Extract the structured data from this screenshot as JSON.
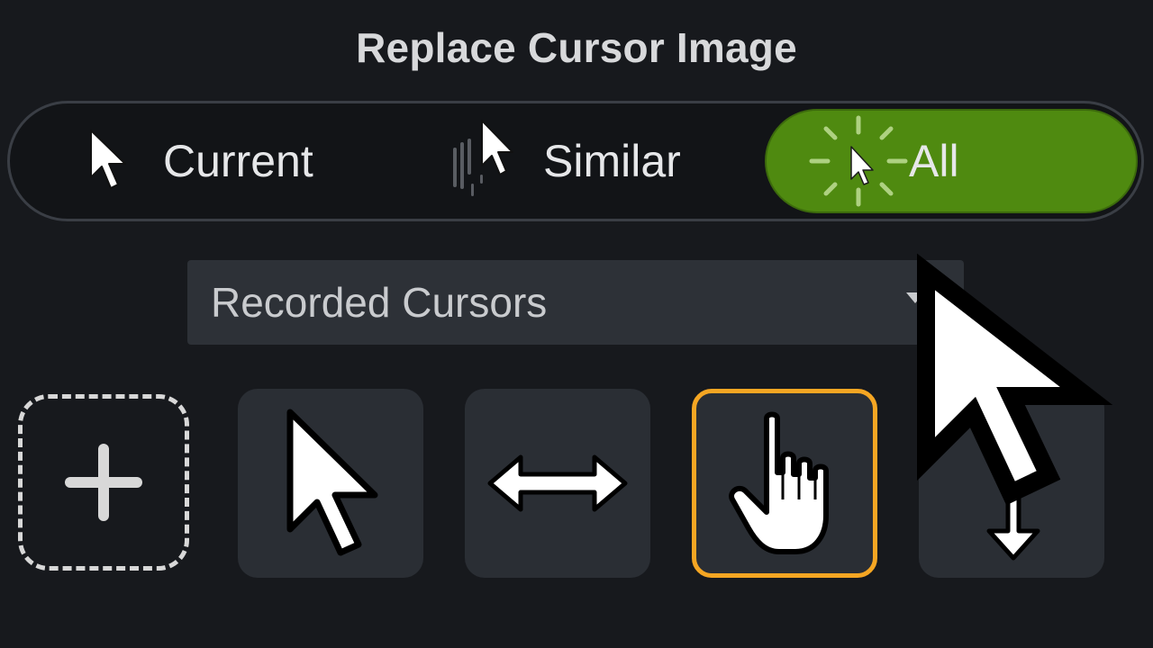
{
  "dialog": {
    "title": "Replace Cursor Image"
  },
  "scope_toggle": {
    "options": [
      {
        "label": "Current",
        "icon": "arrow-cursor-icon",
        "selected": false
      },
      {
        "label": "Similar",
        "icon": "similar-cursor-icon",
        "selected": false
      },
      {
        "label": "All",
        "icon": "all-cursors-icon",
        "selected": true
      }
    ],
    "selected_color": "#4f8a10"
  },
  "cursor_source": {
    "selected": "Recorded Cursors"
  },
  "cursor_tiles": [
    {
      "icon": "add-icon",
      "kind": "add"
    },
    {
      "icon": "arrow-cursor-icon",
      "selected": false
    },
    {
      "icon": "horizontal-resize-cursor-icon",
      "selected": false
    },
    {
      "icon": "hand-pointer-cursor-icon",
      "selected": true
    },
    {
      "icon": "down-arrow-cursor-icon",
      "selected": false
    }
  ],
  "highlight_color": "#f5a623",
  "overlay": {
    "icon": "large-mouse-pointer-icon"
  }
}
